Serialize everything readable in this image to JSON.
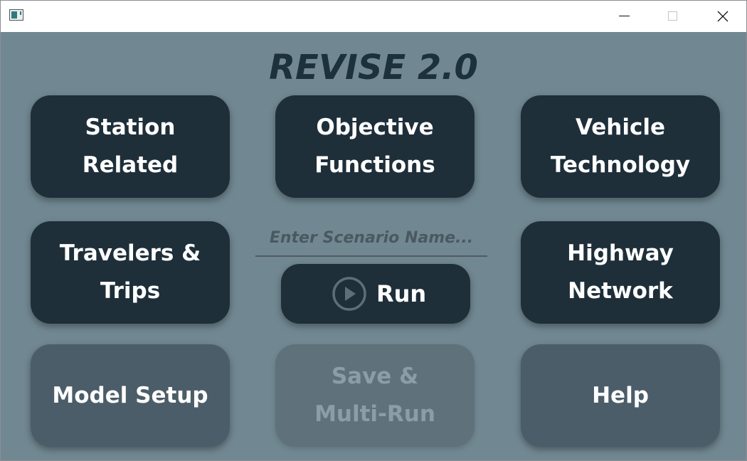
{
  "window": {
    "icon": "app-window-icon",
    "controls": [
      "minimize-icon",
      "maximize-icon",
      "close-icon"
    ]
  },
  "app_title": "REVISE 2.0",
  "tiles": {
    "station_related": "Station\nRelated",
    "objective_functions": "Objective\nFunctions",
    "vehicle_technology": "Vehicle\nTechnology",
    "travelers_trips": "Travelers &\nTrips",
    "highway_network": "Highway\nNetwork",
    "model_setup": "Model Setup",
    "save_multi_run": "Save &\nMulti-Run",
    "help": "Help"
  },
  "scenario": {
    "placeholder": "Enter Scenario Name...",
    "value": ""
  },
  "run": {
    "label": "Run",
    "icon": "play-circle-icon"
  },
  "colors": {
    "background": "#718892",
    "primary_button": "#1e2f3a",
    "secondary_button": "#4b5d68",
    "disabled_button": "#5f717b",
    "title_text": "#1d313c"
  }
}
